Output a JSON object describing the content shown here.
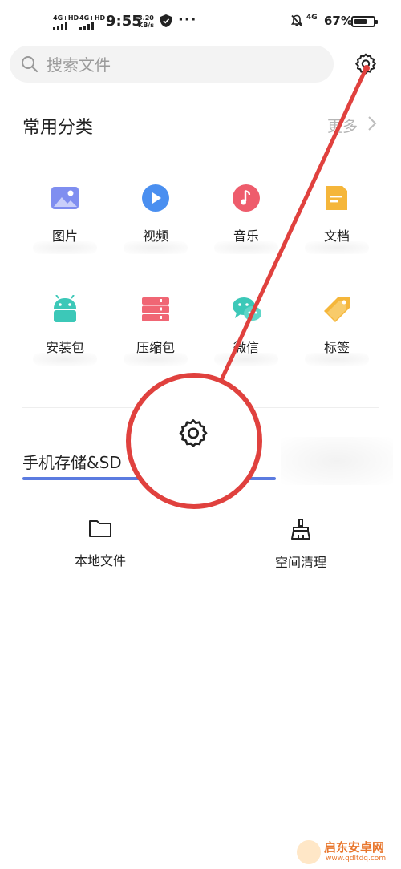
{
  "status_bar": {
    "signal1": "4G+HD",
    "signal2": "4G+HD",
    "time": "9:55",
    "speed_value": "3.20",
    "speed_unit": "KB/s",
    "more_dots": "···",
    "network": "4G",
    "battery_percent": "67%",
    "battery_level": 0.67
  },
  "search": {
    "placeholder": "搜索文件",
    "icon": "search-icon"
  },
  "settings_icon": "gear-icon",
  "common_categories": {
    "title": "常用分类",
    "more_label": "更多",
    "items": [
      {
        "label": "图片",
        "icon": "image-icon",
        "color": "#7f8ef0"
      },
      {
        "label": "视频",
        "icon": "video-icon",
        "color": "#4a8ff0"
      },
      {
        "label": "音乐",
        "icon": "music-icon",
        "color": "#ee5c6c"
      },
      {
        "label": "文档",
        "icon": "document-icon",
        "color": "#f5b63a"
      },
      {
        "label": "安装包",
        "icon": "android-icon",
        "color": "#3cc8b8"
      },
      {
        "label": "压缩包",
        "icon": "archive-icon",
        "color": "#f06674"
      },
      {
        "label": "微信",
        "icon": "wechat-icon",
        "color": "#3cc8b8"
      },
      {
        "label": "标签",
        "icon": "tag-icon",
        "color": "#f5b63a"
      }
    ]
  },
  "storage": {
    "title": "手机存储&SD",
    "bar_color": "#5b7be0"
  },
  "actions": [
    {
      "label": "本地文件",
      "icon": "folder-icon"
    },
    {
      "label": "空间清理",
      "icon": "broom-icon"
    }
  ],
  "annotation": {
    "color": "#e0413e",
    "zoom_icon": "gear-icon"
  },
  "watermark": {
    "name": "启东安卓网",
    "url": "www.qdltdq.com"
  }
}
